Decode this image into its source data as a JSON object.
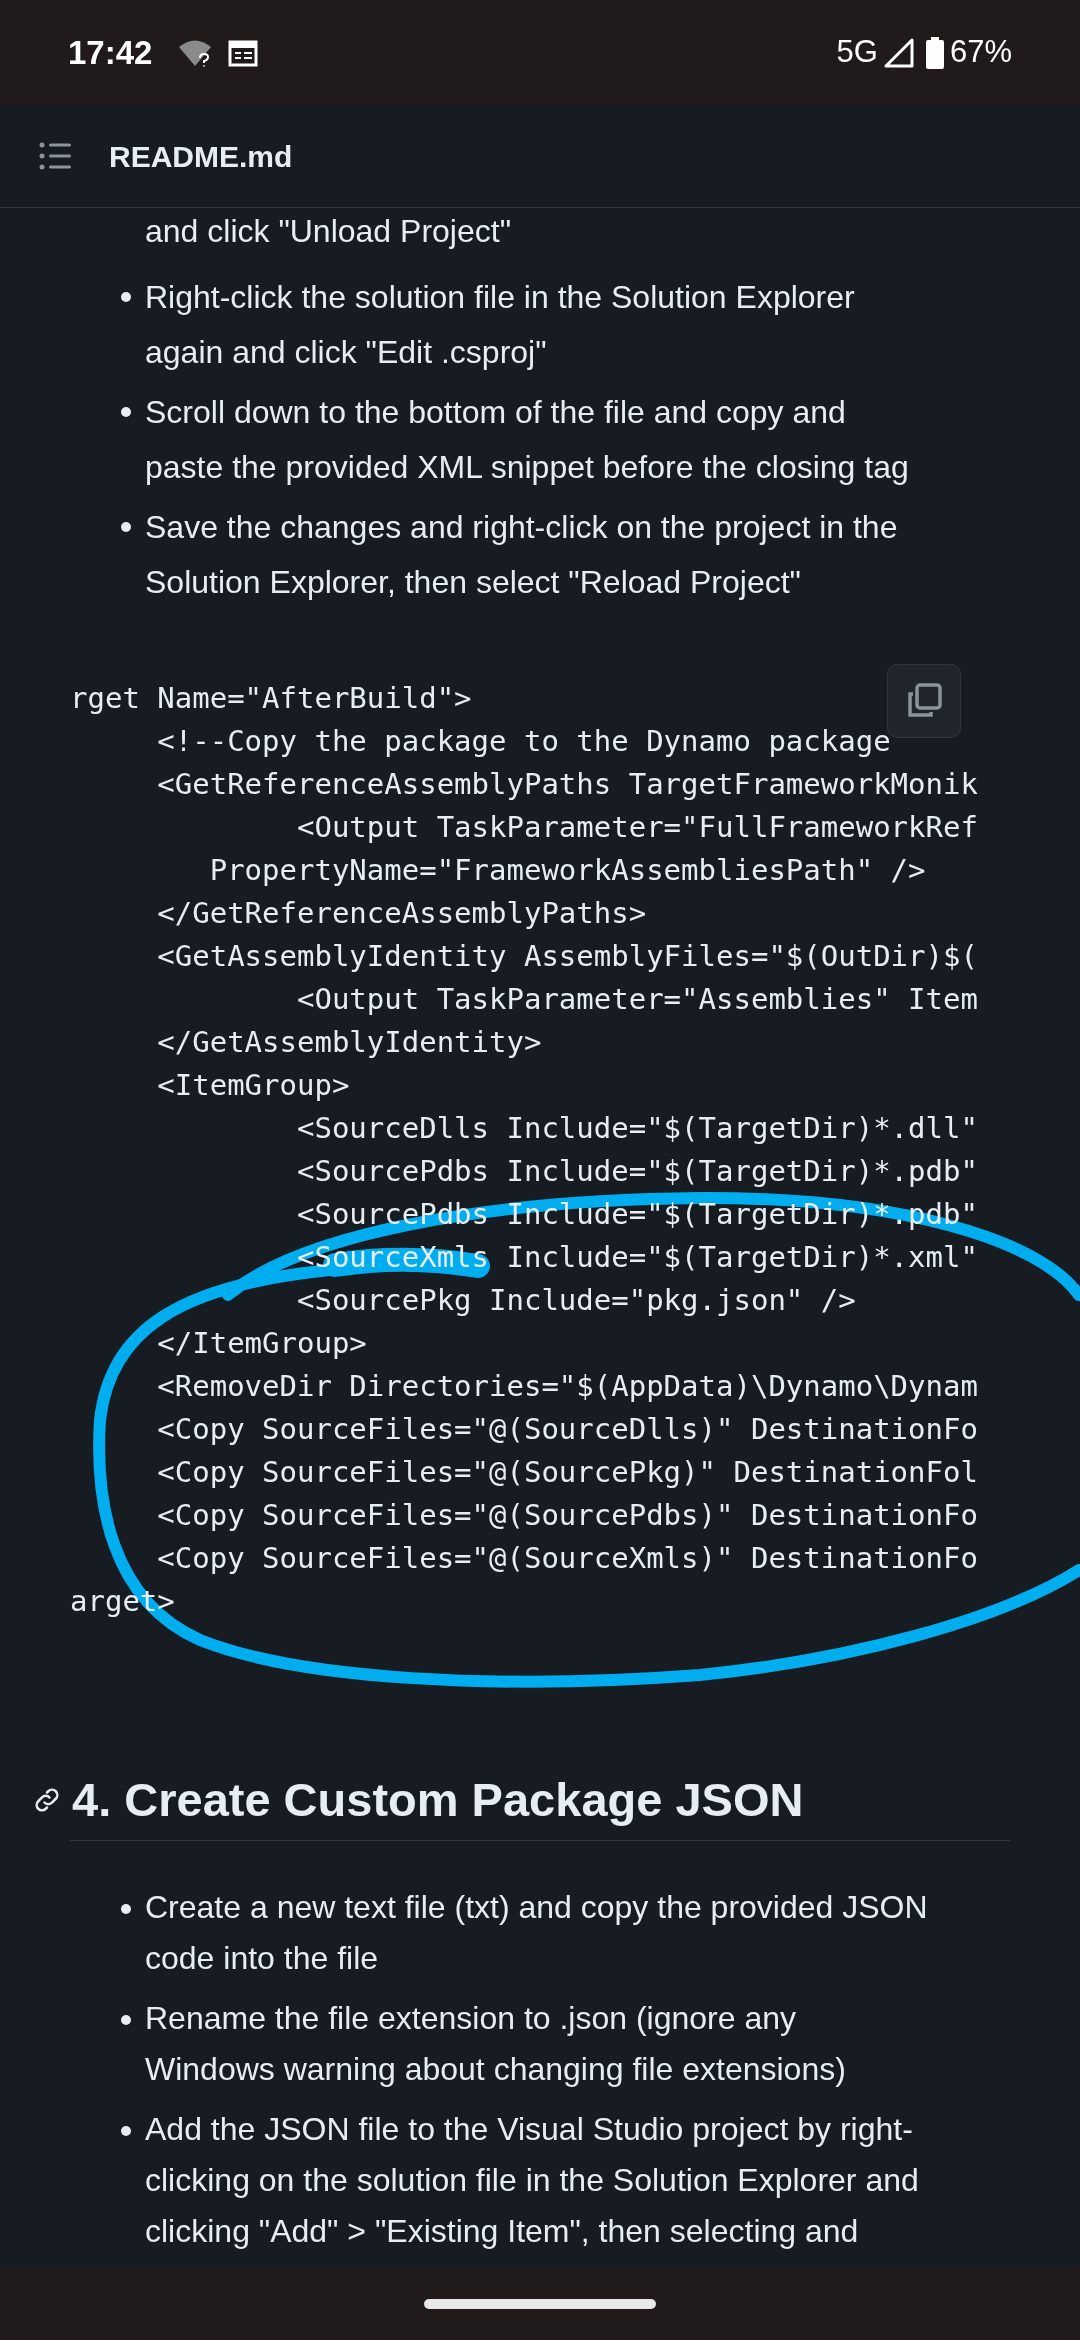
{
  "status_bar": {
    "time": "17:42",
    "network": "5G",
    "battery": "67%"
  },
  "header": {
    "title": "README.md"
  },
  "list_top": {
    "continuation": "and click \"Unload Project\"",
    "items": [
      {
        "lines": [
          "Right-click the solution file in the Solution Explorer",
          "again and click \"Edit .csproj\""
        ]
      },
      {
        "lines": [
          "Scroll down to the bottom of the file and copy and",
          "paste the provided XML snippet before the closing tag"
        ]
      },
      {
        "lines": [
          "Save the changes and right-click on the project in the",
          "Solution Explorer, then select \"Reload Project\""
        ]
      }
    ]
  },
  "code_block": {
    "lines": [
      "rget Name=\"AfterBuild\">",
      "     <!--Copy the package to the Dynamo package",
      "     <GetReferenceAssemblyPaths TargetFrameworkMonik",
      "             <Output TaskParameter=\"FullFrameworkRef",
      "        PropertyName=\"FrameworkAssembliesPath\" />",
      "     </GetReferenceAssemblyPaths>",
      "     <GetAssemblyIdentity AssemblyFiles=\"$(OutDir)$(",
      "             <Output TaskParameter=\"Assemblies\" Item",
      "     </GetAssemblyIdentity>",
      "     <ItemGroup>",
      "             <SourceDlls Include=\"$(TargetDir)*.dll\"",
      "             <SourcePdbs Include=\"$(TargetDir)*.pdb\"",
      "             <SourcePdbs Include=\"$(TargetDir)*.pdb\"",
      "             <SourceXmls Include=\"$(TargetDir)*.xml\"",
      "             <SourcePkg Include=\"pkg.json\" />",
      "     </ItemGroup>",
      "     <RemoveDir Directories=\"$(AppData)\\Dynamo\\Dynam",
      "     <Copy SourceFiles=\"@(SourceDlls)\" DestinationFo",
      "     <Copy SourceFiles=\"@(SourcePkg)\" DestinationFol",
      "     <Copy SourceFiles=\"@(SourcePdbs)\" DestinationFo",
      "     <Copy SourceFiles=\"@(SourceXmls)\" DestinationFo",
      "arget>"
    ]
  },
  "section": {
    "heading": "4. Create Custom Package JSON",
    "items": [
      {
        "lines": [
          "Create a new text file (txt) and copy the provided JSON",
          "code into the file"
        ]
      },
      {
        "lines": [
          "Rename the file extension to .json (ignore any",
          "Windows warning about changing file extensions)"
        ]
      },
      {
        "lines": [
          "Add the JSON file to the Visual Studio project by right-",
          "clicking on the solution file in the Solution Explorer and",
          "clicking \"Add\" > \"Existing Item\", then selecting and"
        ]
      }
    ]
  }
}
